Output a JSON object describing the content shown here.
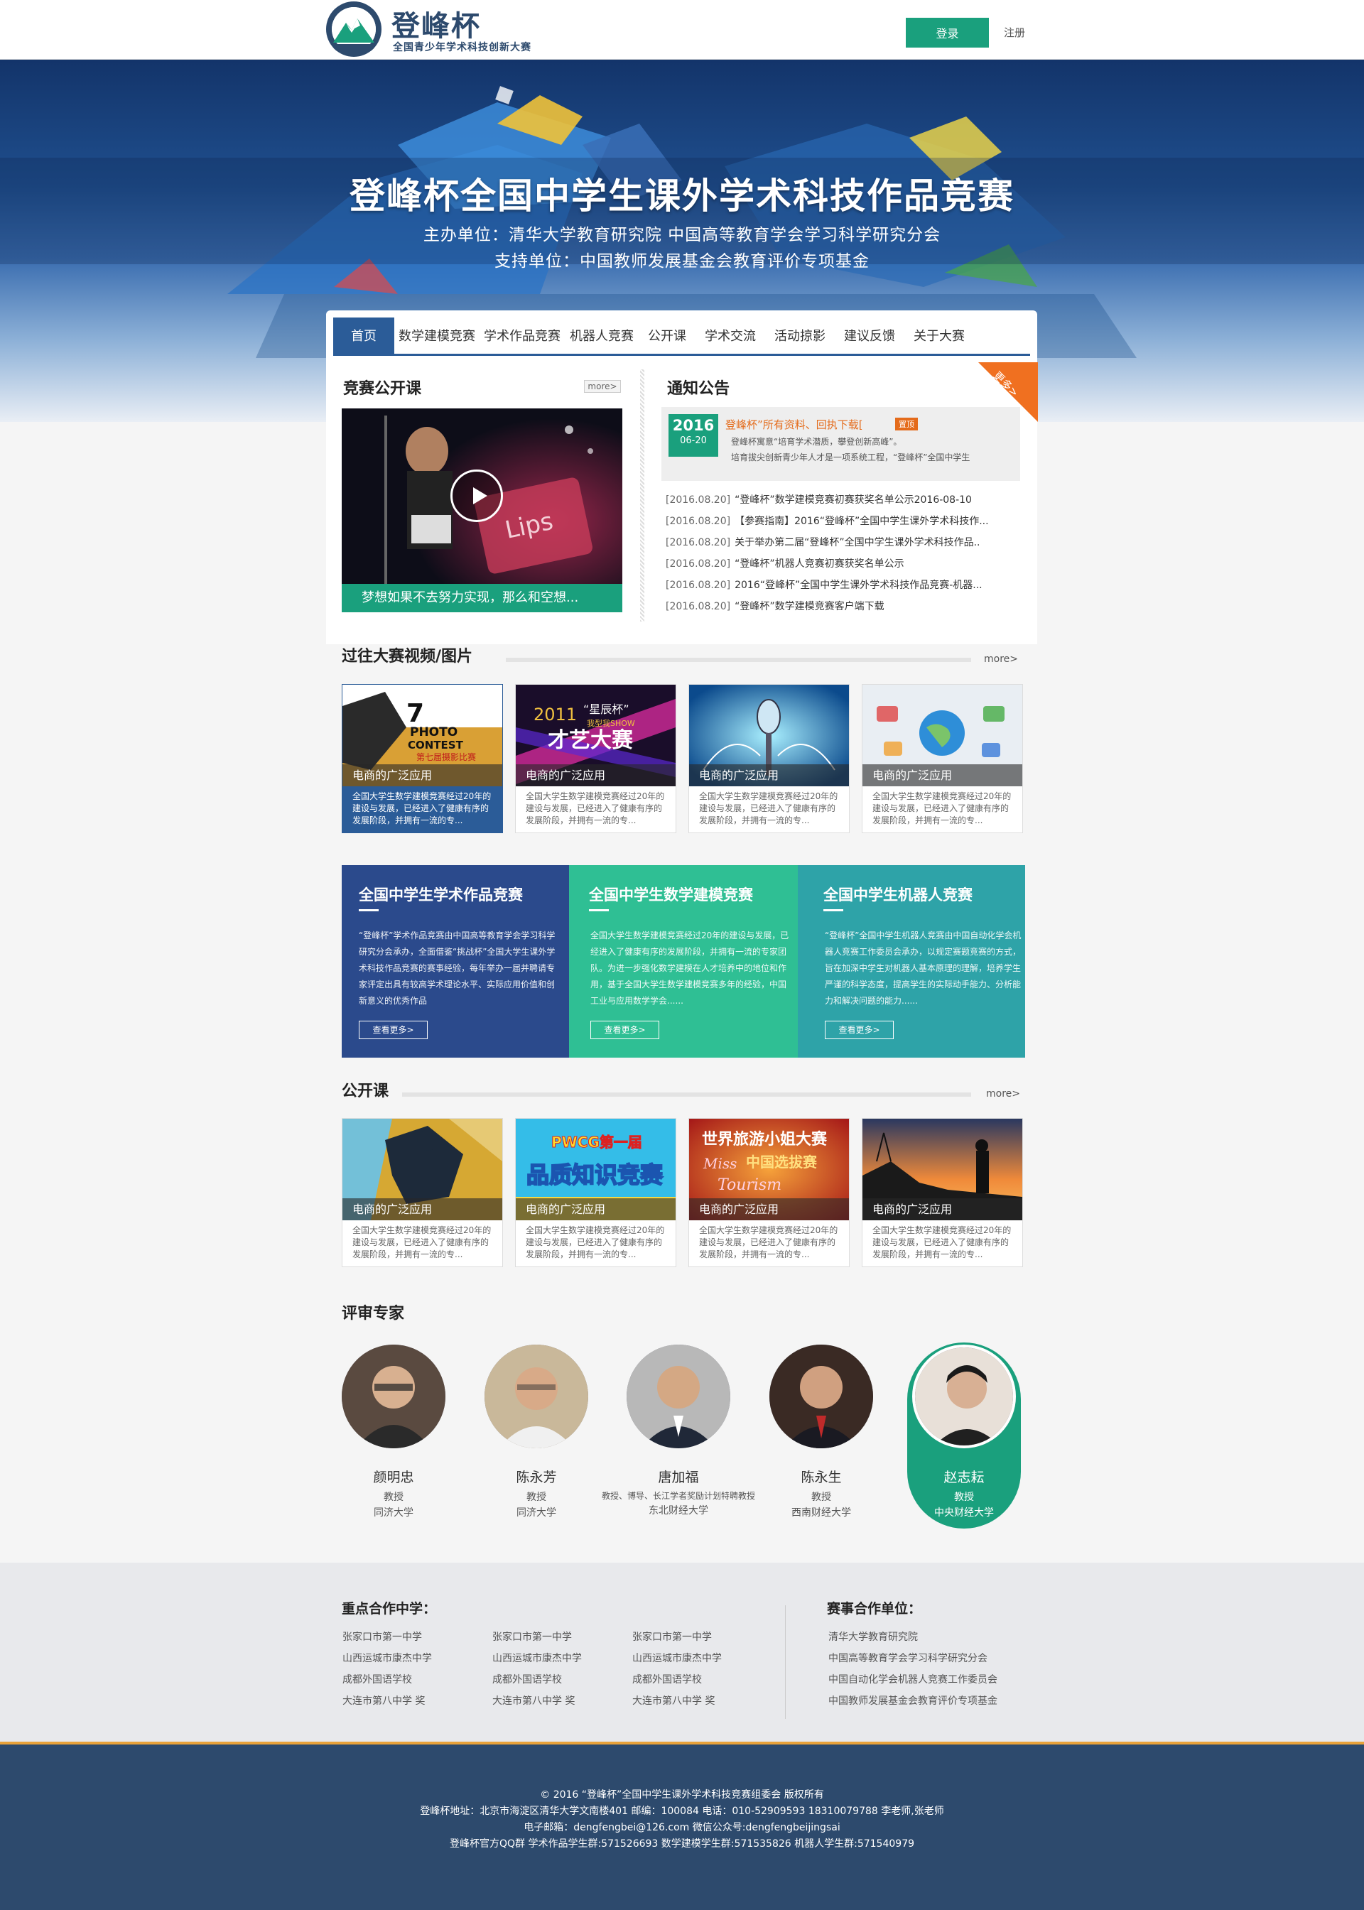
{
  "header": {
    "logo_title": "登峰杯",
    "logo_subtitle": "全国青少年学术科技创新大赛",
    "login_label": "登录",
    "register_label": "注册"
  },
  "banner": {
    "title": "登峰杯全国中学生课外学术科技作品竞赛",
    "organizers": "主办单位：清华大学教育研究院     中国高等教育学会学习科学研究分会",
    "supporter": "支持单位：中国教师发展基金会教育评价专项基金"
  },
  "nav": {
    "items": [
      {
        "label": "首页",
        "active": true
      },
      {
        "label": "数学建模竞赛"
      },
      {
        "label": "学术作品竞赛"
      },
      {
        "label": "机器人竞赛"
      },
      {
        "label": "公开课"
      },
      {
        "label": "学术交流"
      },
      {
        "label": "活动掠影"
      },
      {
        "label": "建议反馈"
      },
      {
        "label": "关于大赛"
      }
    ]
  },
  "open_class": {
    "title": "竞赛公开课",
    "more": "more>",
    "video_caption": "梦想如果不去努力实现，那么和空想..."
  },
  "notice": {
    "title": "通知公告",
    "ribbon": "更多>",
    "featured": {
      "year": "2016",
      "date": "06-20",
      "headline": "登峰杯”所有资料、回执下载[",
      "tag": "置顶",
      "desc1": "登峰杯寓意“培育学术潜质，攀登创新高峰”。",
      "desc2": "培育拔尖创新青少年人才是一项系统工程，“登峰杯”全国中学生"
    },
    "items": [
      {
        "date": "[2016.08.20]",
        "text": "“登峰杯”数学建模竞赛初赛获奖名单公示2016-08-10"
      },
      {
        "date": "[2016.08.20]",
        "text": "【参赛指南】2016“登峰杯”全国中学生课外学术科技作..."
      },
      {
        "date": "[2016.08.20]",
        "text": "关于举办第二届“登峰杯”全国中学生课外学术科技作品.."
      },
      {
        "date": "[2016.08.20]",
        "text": "“登峰杯”机器人竞赛初赛获奖名单公示"
      },
      {
        "date": "[2016.08.20]",
        "text": "2016“登峰杯”全国中学生课外学术科技作品竞赛-机器..."
      },
      {
        "date": "[2016.08.20]",
        "text": "“登峰杯”数学建模竞赛客户端下载"
      }
    ]
  },
  "past_media": {
    "title": "过往大赛视频/图片",
    "more": "more>",
    "cards": [
      {
        "caption": "电商的广泛应用",
        "desc": "全国大学生数学建模竞赛经过20年的建设与发展，已经进入了健康有序的发展阶段，并拥有一流的专...",
        "img_text": "7th PHOTO CONTEST 第七届摄影比赛"
      },
      {
        "caption": "电商的广泛应用",
        "desc": "全国大学生数学建模竞赛经过20年的建设与发展，已经进入了健康有序的发展阶段，并拥有一流的专...",
        "img_text": "2011“星辰杯” 我型我SHOW 才艺大赛"
      },
      {
        "caption": "电商的广泛应用",
        "desc": "全国大学生数学建模竞赛经过20年的建设与发展，已经进入了健康有序的发展阶段，并拥有一流的专...",
        "img_text": ""
      },
      {
        "caption": "电商的广泛应用",
        "desc": "全国大学生数学建模竞赛经过20年的建设与发展，已经进入了健康有序的发展阶段，并拥有一流的专...",
        "img_text": ""
      }
    ]
  },
  "competitions": [
    {
      "title": "全国中学生学术作品竞赛",
      "text": "“登峰杯”学术作品竞赛由中国高等教育学会学习科学研究分会承办，全面借鉴“挑战杯”全国大学生课外学术科技作品竞赛的赛事经验，每年举办一届并聘请专家评定出具有较高学术理论水平、实际应用价值和创新意义的优秀作品",
      "button": "查看更多>",
      "color": "#2b4a8c"
    },
    {
      "title": "全国中学生数学建模竞赛",
      "text": "全国大学生数学建模竞赛经过20年的建设与发展，已经进入了健康有序的发展阶段，并拥有一流的专家团队。为进一步强化数学建模在人才培养中的地位和作用，基于全国大学生数学建模竞赛多年的经验，中国工业与应用数学学会......",
      "button": "查看更多>",
      "color": "#2fbf94"
    },
    {
      "title": "全国中学生机器人竞赛",
      "text": "“登峰杯”全国中学生机器人竞赛由中国自动化学会机器人竞赛工作委员会承办，以规定赛题竞赛的方式，旨在加深中学生对机器人基本原理的理解，培养学生严谨的科学态度，提高学生的实际动手能力、分析能力和解决问题的能力......",
      "button": "查看更多>",
      "color": "#2ea3a8"
    }
  ],
  "public_class": {
    "title": "公开课",
    "more": "more>",
    "cards": [
      {
        "caption": "电商的广泛应用",
        "desc": "全国大学生数学建模竞赛经过20年的建设与发展，已经进入了健康有序的发展阶段，并拥有一流的专...",
        "img_text": ""
      },
      {
        "caption": "电商的广泛应用",
        "desc": "全国大学生数学建模竞赛经过20年的建设与发展，已经进入了健康有序的发展阶段，并拥有一流的专...",
        "img_text": "PWCG第一届 品质知识竞赛"
      },
      {
        "caption": "电商的广泛应用",
        "desc": "全国大学生数学建模竞赛经过20年的建设与发展，已经进入了健康有序的发展阶段，并拥有一流的专...",
        "img_text": "世界旅游小姐大赛 中国选拔赛 Miss Tourism"
      },
      {
        "caption": "电商的广泛应用",
        "desc": "全国大学生数学建模竞赛经过20年的建设与发展，已经进入了健康有序的发展阶段，并拥有一流的专...",
        "img_text": ""
      }
    ]
  },
  "experts": {
    "title": "评审专家",
    "people": [
      {
        "name": "颜明忠",
        "title": "教授",
        "org": "同济大学"
      },
      {
        "name": "陈永芳",
        "title": "教授",
        "org": "同济大学"
      },
      {
        "name": "唐加福",
        "title": "教授、博导、长江学者奖励计划特聘教授",
        "org": "东北财经大学"
      },
      {
        "name": "陈永生",
        "title": "教授",
        "org": "西南财经大学"
      },
      {
        "name": "赵志耘",
        "title": "教授",
        "org": "中央财经大学",
        "highlight": true
      }
    ]
  },
  "partners": {
    "schools_title": "重点合作中学：",
    "schools_col1": [
      "张家口市第一中学",
      "山西运城市康杰中学",
      "成都外国语学校",
      "大连市第八中学 奖"
    ],
    "schools_col2": [
      "张家口市第一中学",
      "山西运城市康杰中学",
      "成都外国语学校",
      "大连市第八中学 奖"
    ],
    "schools_col3": [
      "张家口市第一中学",
      "山西运城市康杰中学",
      "成都外国语学校",
      "大连市第八中学 奖"
    ],
    "units_title": "赛事合作单位：",
    "units": [
      "清华大学教育研究院",
      "中国高等教育学会学习科学研究分会",
      "中国自动化学会机器人竞赛工作委员会",
      "中国教师发展基金会教育评价专项基金"
    ]
  },
  "footer": {
    "copyright": "© 2016 “登峰杯”全国中学生课外学术科技竞赛组委会 版权所有",
    "address": "登峰杯地址：北京市海淀区清华大学文南楼401  邮编：100084        电话：010-52909593 18310079788 李老师,张老师",
    "email": "电子邮箱：dengfengbei@126.com  微信公众号:dengfengbeijingsai",
    "qq": "登峰杯官方QQ群    学术作品学生群:571526693  数学建模学生群:571535826  机器人学生群:571540979"
  },
  "colors": {
    "primary_blue": "#2b5c98",
    "accent_green": "#1aa07d",
    "accent_orange": "#e46b1b",
    "footer_bg": "#2d4a6d"
  }
}
